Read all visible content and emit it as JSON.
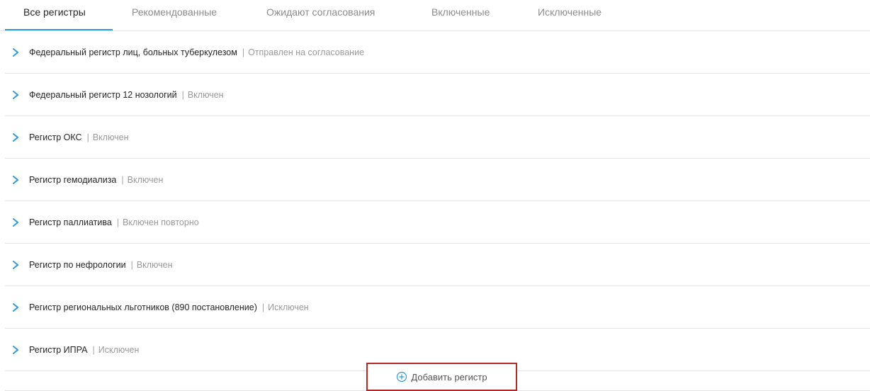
{
  "tabs": [
    {
      "label": "Все регистры",
      "active": true
    },
    {
      "label": "Рекомендованные",
      "active": false
    },
    {
      "label": "Ожидают согласования",
      "active": false
    },
    {
      "label": "Включенные",
      "active": false
    },
    {
      "label": "Исключенные",
      "active": false
    }
  ],
  "registers": [
    {
      "name": "Федеральный регистр лиц, больных туберкулезом",
      "separator": "|",
      "status": "Отправлен на согласование"
    },
    {
      "name": "Федеральный регистр 12 нозологий",
      "separator": "|",
      "status": "Включен"
    },
    {
      "name": "Регистр ОКС",
      "separator": "|",
      "status": "Включен"
    },
    {
      "name": "Регистр гемодиализа",
      "separator": "|",
      "status": "Включен"
    },
    {
      "name": "Регистр паллиатива",
      "separator": "|",
      "status": "Включен повторно"
    },
    {
      "name": "Регистр по нефрологии",
      "separator": "|",
      "status": "Включен"
    },
    {
      "name": "Регистр региональных льготников (890 постановление)",
      "separator": "|",
      "status": "Исключен"
    },
    {
      "name": "Регистр ИПРА",
      "separator": "|",
      "status": "Исключен"
    }
  ],
  "add_button": {
    "label": "Добавить регистр",
    "icon": "plus-circle-icon"
  },
  "colors": {
    "accent": "#2f9bd6",
    "chevron": "#2f9bd6",
    "highlight_border": "#b32a2a"
  }
}
